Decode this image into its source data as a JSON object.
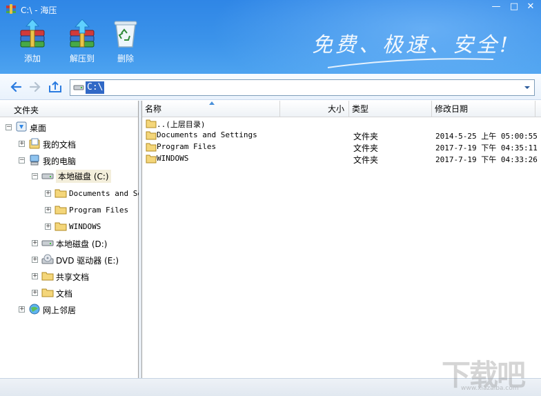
{
  "window": {
    "title": "C:\\ - 海压",
    "minimize": "—",
    "maximize": "□",
    "close": "✕"
  },
  "toolbar": {
    "add_label": "添加",
    "extract_label": "解压到",
    "delete_label": "删除"
  },
  "slogan": "免费、极速、安全!",
  "address": {
    "path": "C:\\"
  },
  "tree": {
    "header": "文件夹",
    "items": [
      {
        "label": "桌面",
        "expander": "−",
        "icon": "desktop-icon"
      },
      {
        "label": "我的文档",
        "expander": "+",
        "icon": "documents-icon"
      },
      {
        "label": "我的电脑",
        "expander": "−",
        "icon": "computer-icon"
      },
      {
        "label": "本地磁盘 (C:)",
        "expander": "−",
        "icon": "drive-icon"
      },
      {
        "label": "Documents and Se",
        "expander": "+",
        "icon": "folder-icon"
      },
      {
        "label": "Program Files",
        "expander": "+",
        "icon": "folder-icon"
      },
      {
        "label": "WINDOWS",
        "expander": "+",
        "icon": "folder-icon"
      },
      {
        "label": "本地磁盘 (D:)",
        "expander": "+",
        "icon": "drive-icon"
      },
      {
        "label": "DVD 驱动器 (E:)",
        "expander": "+",
        "icon": "dvd-icon"
      },
      {
        "label": "共享文档",
        "expander": "+",
        "icon": "folder-icon"
      },
      {
        "label": "文档",
        "expander": "+",
        "icon": "folder-icon"
      },
      {
        "label": "网上邻居",
        "expander": "+",
        "icon": "network-icon"
      }
    ]
  },
  "list": {
    "columns": {
      "name": "名称",
      "size": "大小",
      "type": "类型",
      "modified": "修改日期"
    },
    "rows": [
      {
        "name": "..(上层目录)",
        "type": "",
        "modified": ""
      },
      {
        "name": "Documents and Settings",
        "type": "文件夹",
        "modified": "2014-5-25 上午 05:00:55"
      },
      {
        "name": "Program Files",
        "type": "文件夹",
        "modified": "2017-7-19 下午 04:35:11"
      },
      {
        "name": "WINDOWS",
        "type": "文件夹",
        "modified": "2017-7-19 下午 04:33:26"
      }
    ]
  },
  "watermark": {
    "logo": "下载吧",
    "url": "www.xiazaiba.com"
  }
}
